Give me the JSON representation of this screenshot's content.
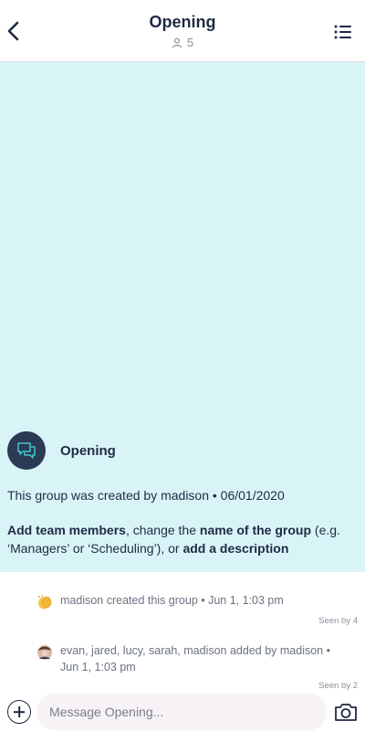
{
  "header": {
    "title": "Opening",
    "member_count": "5"
  },
  "hero": {
    "group_name": "Opening",
    "created_text": "This group was created by madison • 06/01/2020",
    "cta": {
      "add_members": "Add team members",
      "text_1": ", change the ",
      "name_of_group": "name of the group",
      "text_2": " (e.g. ‘Managers’ or ‘Scheduling’), or ",
      "add_description": "add a description"
    }
  },
  "activity": [
    {
      "text": "madison created this group  •  Jun 1, 1:03 pm",
      "seen": "Seen by 4",
      "icon": "clapping-hands-icon"
    },
    {
      "text": "evan, jared, lucy, sarah, madison added by madison  •  Jun 1, 1:03 pm",
      "seen": "Seen by 2",
      "icon": "user-avatar-icon"
    }
  ],
  "composer": {
    "placeholder": "Message Opening..."
  },
  "colors": {
    "hero_bg": "#d9f4f6",
    "avatar_bg": "#2b3a55",
    "accent": "#3fc6c9",
    "text": "#1f2a44"
  }
}
